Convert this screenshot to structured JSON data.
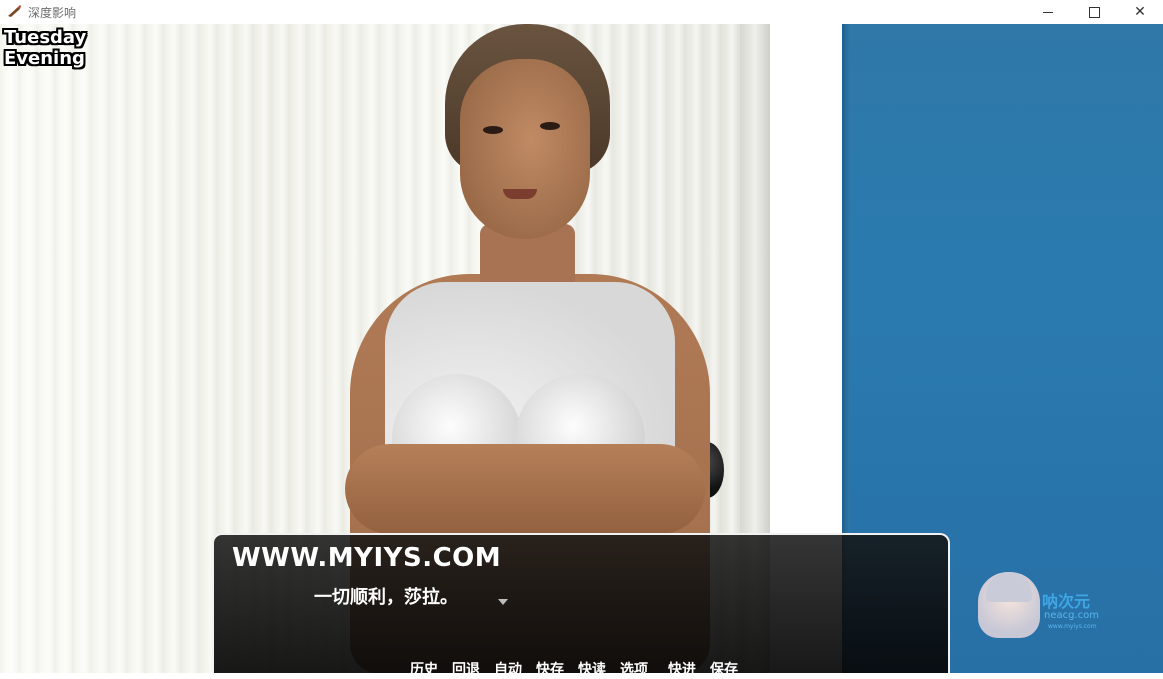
{
  "window": {
    "title": "深度影响",
    "controls": {
      "minimize": "",
      "maximize": "",
      "close": "✕"
    }
  },
  "hud": {
    "day": "Tuesday",
    "time_of_day": "Evening"
  },
  "dialog": {
    "speaker": "WWW.MYIYS.COM",
    "text": "一切顺利，莎拉。"
  },
  "quick_menu": [
    "历史",
    "回退",
    "自动",
    "快存",
    "快读",
    "选项",
    "快进",
    "保存"
  ],
  "watermark": {
    "title": "呐次元",
    "url": "neacg.com",
    "sub": "www.myiys.com"
  },
  "colors": {
    "blue_wall": "#2f78a8",
    "dialog_bg": "#0d0d0d",
    "watermark_accent": "#3fa6e6"
  }
}
